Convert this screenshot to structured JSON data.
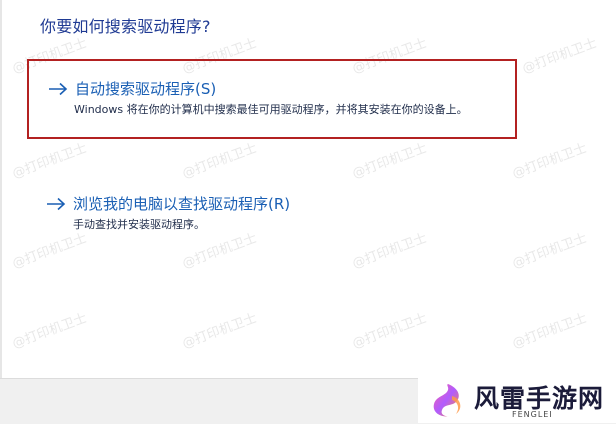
{
  "dialog": {
    "question": "你要如何搜索驱动程序?"
  },
  "options": [
    {
      "title": "自动搜索驱动程序(S)",
      "description": "Windows 将在你的计算机中搜索最佳可用驱动程序，并将其安装在你的设备上。"
    },
    {
      "title": "浏览我的电脑以查找驱动程序(R)",
      "description": "手动查找并安装驱动程序。"
    }
  ],
  "watermark": {
    "text": "@打印机卫士",
    "brand_title": "风雷手游网",
    "brand_sub": "FENGLEI"
  },
  "colors": {
    "question": "#1f3a93",
    "option_title": "#1a5fb4",
    "highlight_border": "#b32121"
  }
}
